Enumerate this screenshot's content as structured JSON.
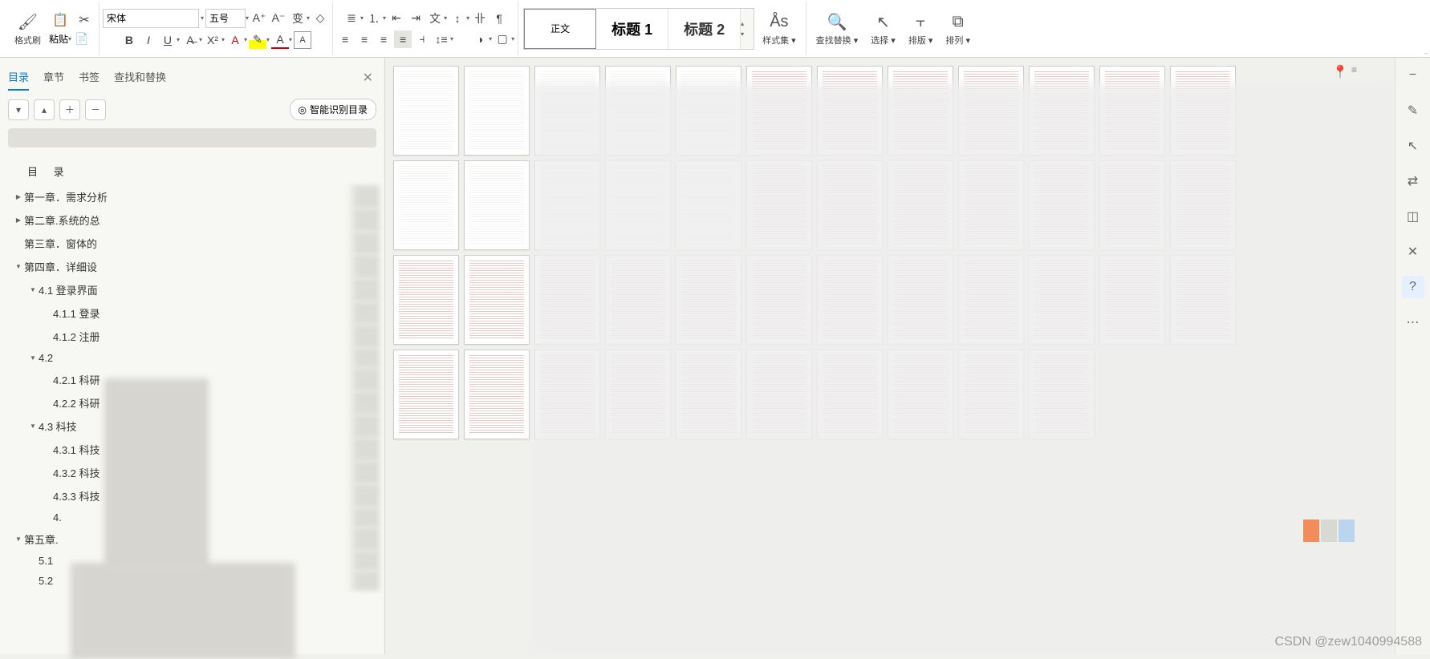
{
  "ribbon": {
    "format_painter": "格式刷",
    "paste": "粘贴",
    "font_name": "宋体",
    "font_size": "五号",
    "styles": {
      "normal": "正文",
      "h1": "标题 1",
      "h2": "标题 2"
    },
    "style_set": "样式集",
    "find_replace": "查找替换",
    "select": "选择",
    "layout": "排版",
    "arrange": "排列"
  },
  "sidebar": {
    "tabs": {
      "toc": "目录",
      "chapters": "章节",
      "bookmarks": "书签",
      "find": "查找和替换"
    },
    "smart_toc": "智能识别目录",
    "toc_title": "目 录",
    "items": [
      {
        "indent": 0,
        "caret": "closed",
        "text": "第一章．需求分析"
      },
      {
        "indent": 0,
        "caret": "closed",
        "text": "第二章.系统的总"
      },
      {
        "indent": 0,
        "caret": "none",
        "text": "第三章．窗体的"
      },
      {
        "indent": 0,
        "caret": "open",
        "text": "第四章．详细设"
      },
      {
        "indent": 1,
        "caret": "open",
        "text": "4.1 登录界面"
      },
      {
        "indent": 2,
        "caret": "none",
        "text": "4.1.1 登录"
      },
      {
        "indent": 2,
        "caret": "none",
        "text": "4.1.2 注册"
      },
      {
        "indent": 1,
        "caret": "open",
        "text": "4.2"
      },
      {
        "indent": 2,
        "caret": "none",
        "text": "4.2.1 科研"
      },
      {
        "indent": 2,
        "caret": "none",
        "text": "4.2.2 科研"
      },
      {
        "indent": 1,
        "caret": "open",
        "text": "4.3 科技"
      },
      {
        "indent": 2,
        "caret": "none",
        "text": "4.3.1 科技"
      },
      {
        "indent": 2,
        "caret": "none",
        "text": "4.3.2 科技"
      },
      {
        "indent": 2,
        "caret": "none",
        "text": "4.3.3 科技"
      },
      {
        "indent": 2,
        "caret": "none",
        "text": "4."
      },
      {
        "indent": 0,
        "caret": "open",
        "text": "第五章."
      },
      {
        "indent": 1,
        "caret": "none",
        "text": "5.1 "
      },
      {
        "indent": 1,
        "caret": "none",
        "text": "5.2 "
      }
    ]
  },
  "watermark": "CSDN @zew1040994588"
}
